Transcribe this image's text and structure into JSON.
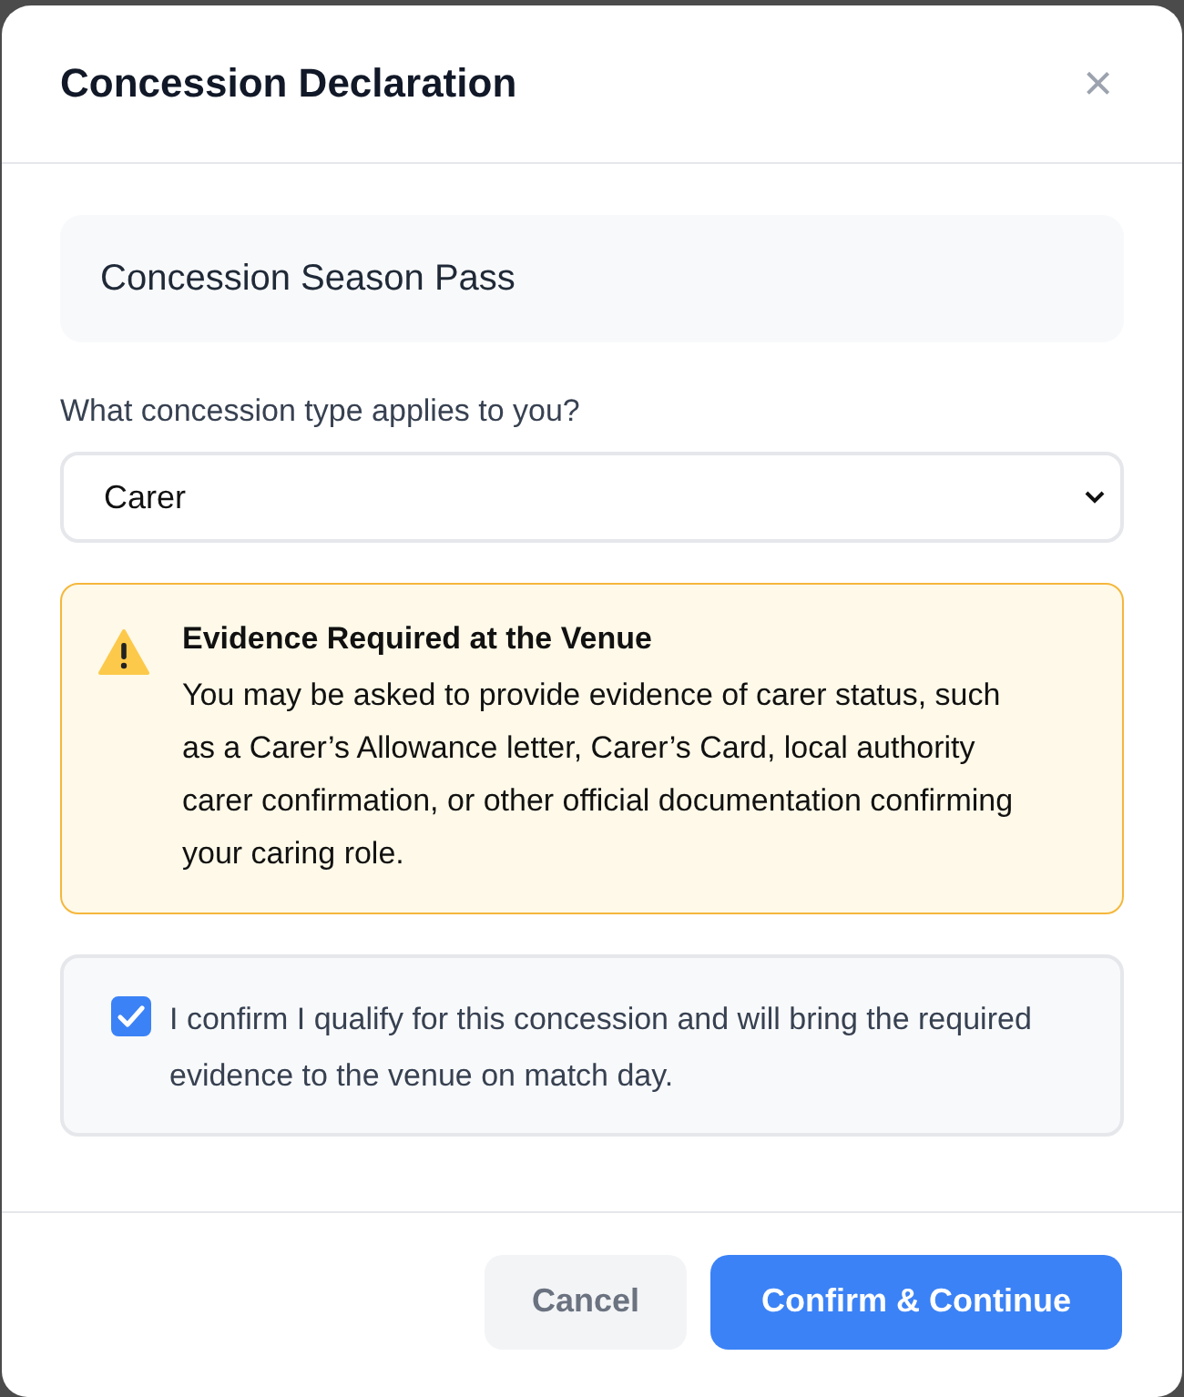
{
  "dialog": {
    "title": "Concession Declaration",
    "close": "×"
  },
  "product": {
    "name": "Concession Season Pass"
  },
  "question": {
    "label": "What concession type applies to you?",
    "value": "Carer"
  },
  "notice": {
    "title": "Evidence Required at the Venue",
    "text": "You may be asked to provide evidence of carer status, such as a Carer’s Allowance letter, Carer’s Card, local authority carer confirmation, or other official documentation confirming your caring role."
  },
  "confirmation": {
    "label": "I confirm I qualify for this concession and will bring the required evidence to the venue on match day.",
    "checked": true
  },
  "buttons": [
    {
      "label": "Cancel",
      "kind": "secondary"
    },
    {
      "label": "Confirm & Continue",
      "kind": "primary"
    }
  ]
}
